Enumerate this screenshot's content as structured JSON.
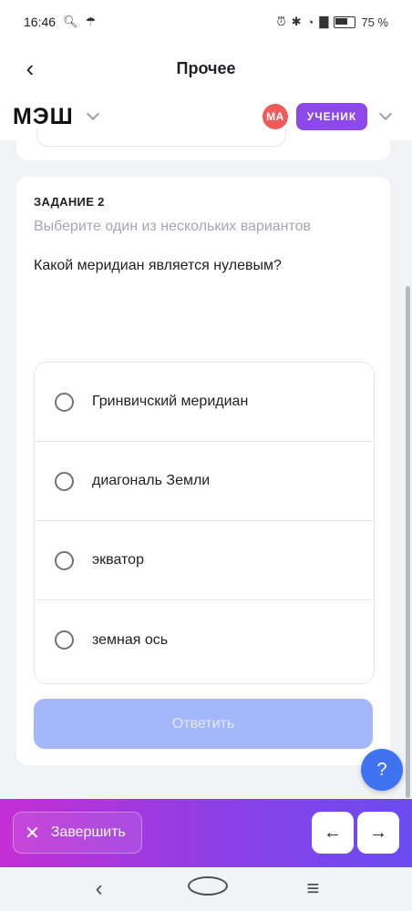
{
  "status_bar": {
    "time": "16:46",
    "battery": "75 %",
    "icons": [
      "search-icon",
      "umbrella-icon",
      "alarm-icon",
      "bluetooth-icon",
      "volte-icon",
      "wifi-icon",
      "signal-icon",
      "battery-icon"
    ]
  },
  "header": {
    "title": "Прочее",
    "back_icon": "chevron-left-icon"
  },
  "brand": {
    "logo": "МЭШ",
    "avatar_initials": "МА",
    "role_label": "УЧЕНИК",
    "avatar_color": "#ef5a5a",
    "role_color": "#8c48e8"
  },
  "task": {
    "number_label": "ЗАДАНИЕ 2",
    "instruction": "Выберите один из нескольких вариантов",
    "question": "Какой меридиан является нулевым?",
    "options": [
      {
        "label": "Гринвичский меридиан"
      },
      {
        "label": "диагональ Земли"
      },
      {
        "label": "экватор"
      },
      {
        "label": "земная ось"
      }
    ],
    "answer_label": "Ответить",
    "answer_color": "#a5b7fb"
  },
  "help": {
    "label": "?",
    "color": "#3f73f2"
  },
  "bottom_bar": {
    "finish_label": "Завершить",
    "prev_icon": "arrow-left-icon",
    "next_icon": "arrow-right-icon"
  },
  "system_nav": {
    "icons": [
      "back-icon",
      "home-icon",
      "menu-icon"
    ]
  }
}
